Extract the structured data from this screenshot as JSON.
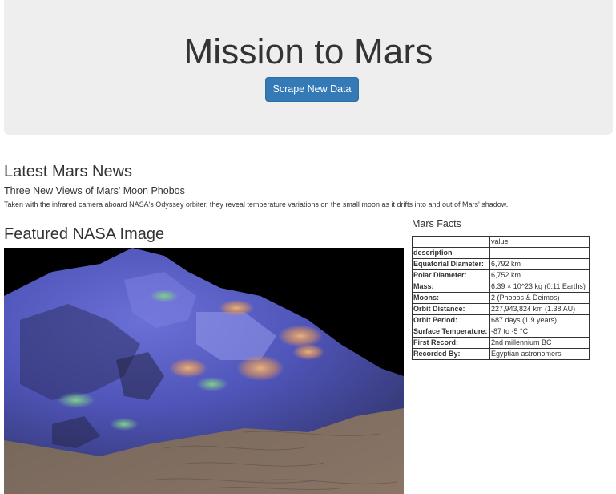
{
  "header": {
    "title": "Mission to Mars",
    "scrape_button": "Scrape New Data"
  },
  "news": {
    "heading": "Latest Mars News",
    "title": "Three New Views of Mars' Moon Phobos",
    "paragraph": "Taken with the infrared camera aboard NASA's Odyssey orbiter, they reveal temperature variations on the small moon as it drifts into and out of Mars' shadow."
  },
  "featured": {
    "heading": "Featured NASA Image",
    "image_icon": "mars-terrain-false-color-image"
  },
  "facts": {
    "heading": "Mars Facts",
    "columns": [
      "",
      "value"
    ],
    "rows": [
      {
        "label": "description",
        "value": ""
      },
      {
        "label": "Equatorial Diameter:",
        "value": "6,792 km"
      },
      {
        "label": "Polar Diameter:",
        "value": "6,752 km"
      },
      {
        "label": "Mass:",
        "value": "6.39 × 10^23 kg (0.11 Earths)"
      },
      {
        "label": "Moons:",
        "value": "2 (Phobos & Deimos)"
      },
      {
        "label": "Orbit Distance:",
        "value": "227,943,824 km (1.38 AU)"
      },
      {
        "label": "Orbit Period:",
        "value": "687 days (1.9 years)"
      },
      {
        "label": "Surface Temperature:",
        "value": "-87 to -5 °C"
      },
      {
        "label": "First Record:",
        "value": "2nd millennium BC"
      },
      {
        "label": "Recorded By:",
        "value": "Egyptian astronomers"
      }
    ]
  },
  "colors": {
    "jumbotron_bg": "#eeeeee",
    "button_primary": "#337ab7"
  }
}
